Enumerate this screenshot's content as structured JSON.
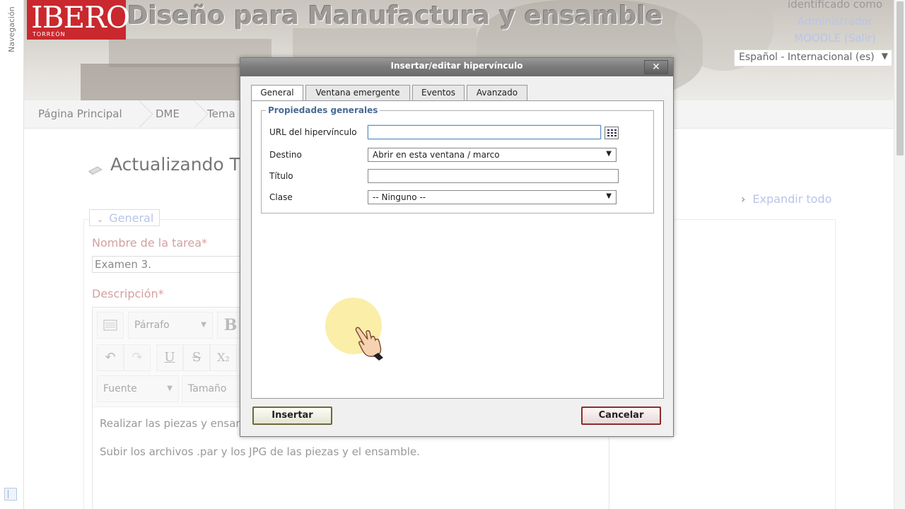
{
  "nav": {
    "vertical_label": "Navegación"
  },
  "header": {
    "logo_text": "IBERO",
    "logo_subtext": "TORREÓN",
    "course_title": "Diseño para Manufactura y ensamble",
    "login": {
      "identified_text": "identificado como",
      "user_name": "Administrador",
      "account_line": "MOODLE (Salir)"
    },
    "language": {
      "selected": "Español - Internacional (es)"
    }
  },
  "breadcrumb": {
    "items": [
      "Página Principal",
      "DME",
      "Tema"
    ]
  },
  "page": {
    "heading": "Actualizando T",
    "expand_all": "Expandir todo",
    "section_legend": "General",
    "field_name_label": "Nombre de la tarea",
    "field_name_value": "Examen 3.",
    "field_desc_label": "Descripción",
    "required_marker": "*"
  },
  "editor": {
    "toolbar": {
      "paragraph_select": "Párrafo",
      "font_select": "Fuente",
      "size_select": "Tamaño",
      "bold_glyph": "B",
      "underline_glyph": "U",
      "strike_glyph": "S",
      "subscript_glyph": "X₂",
      "undo_glyph": "↶",
      "redo_glyph": "↷"
    },
    "content_lines": [
      "Realizar las piezas y ensam",
      "Subir los archivos .par y los JPG de las piezas y  el ensamble."
    ]
  },
  "dialog": {
    "title": "Insertar/editar hipervínculo",
    "close_glyph": "✕",
    "tabs": [
      {
        "label": "General",
        "active": true
      },
      {
        "label": "Ventana emergente",
        "active": false
      },
      {
        "label": "Eventos",
        "active": false
      },
      {
        "label": "Avanzado",
        "active": false
      }
    ],
    "fieldset_legend": "Propiedades generales",
    "fields": {
      "url_label": "URL del hipervínculo",
      "url_value": "",
      "target_label": "Destino",
      "target_value": "Abrir en esta ventana / marco",
      "title_label": "Título",
      "title_value": "",
      "class_label": "Clase",
      "class_value": "-- Ninguno --"
    },
    "buttons": {
      "insert": "Insertar",
      "cancel": "Cancelar"
    }
  },
  "icons": {
    "dropdown": "▼",
    "chevron_right": "›",
    "chevron_down": "⌄"
  },
  "colors": {
    "brand_red": "#c9282e",
    "link_blue": "#b8c5e8",
    "legend_blue": "#4a6a96",
    "required_label": "#d3a0a0"
  }
}
